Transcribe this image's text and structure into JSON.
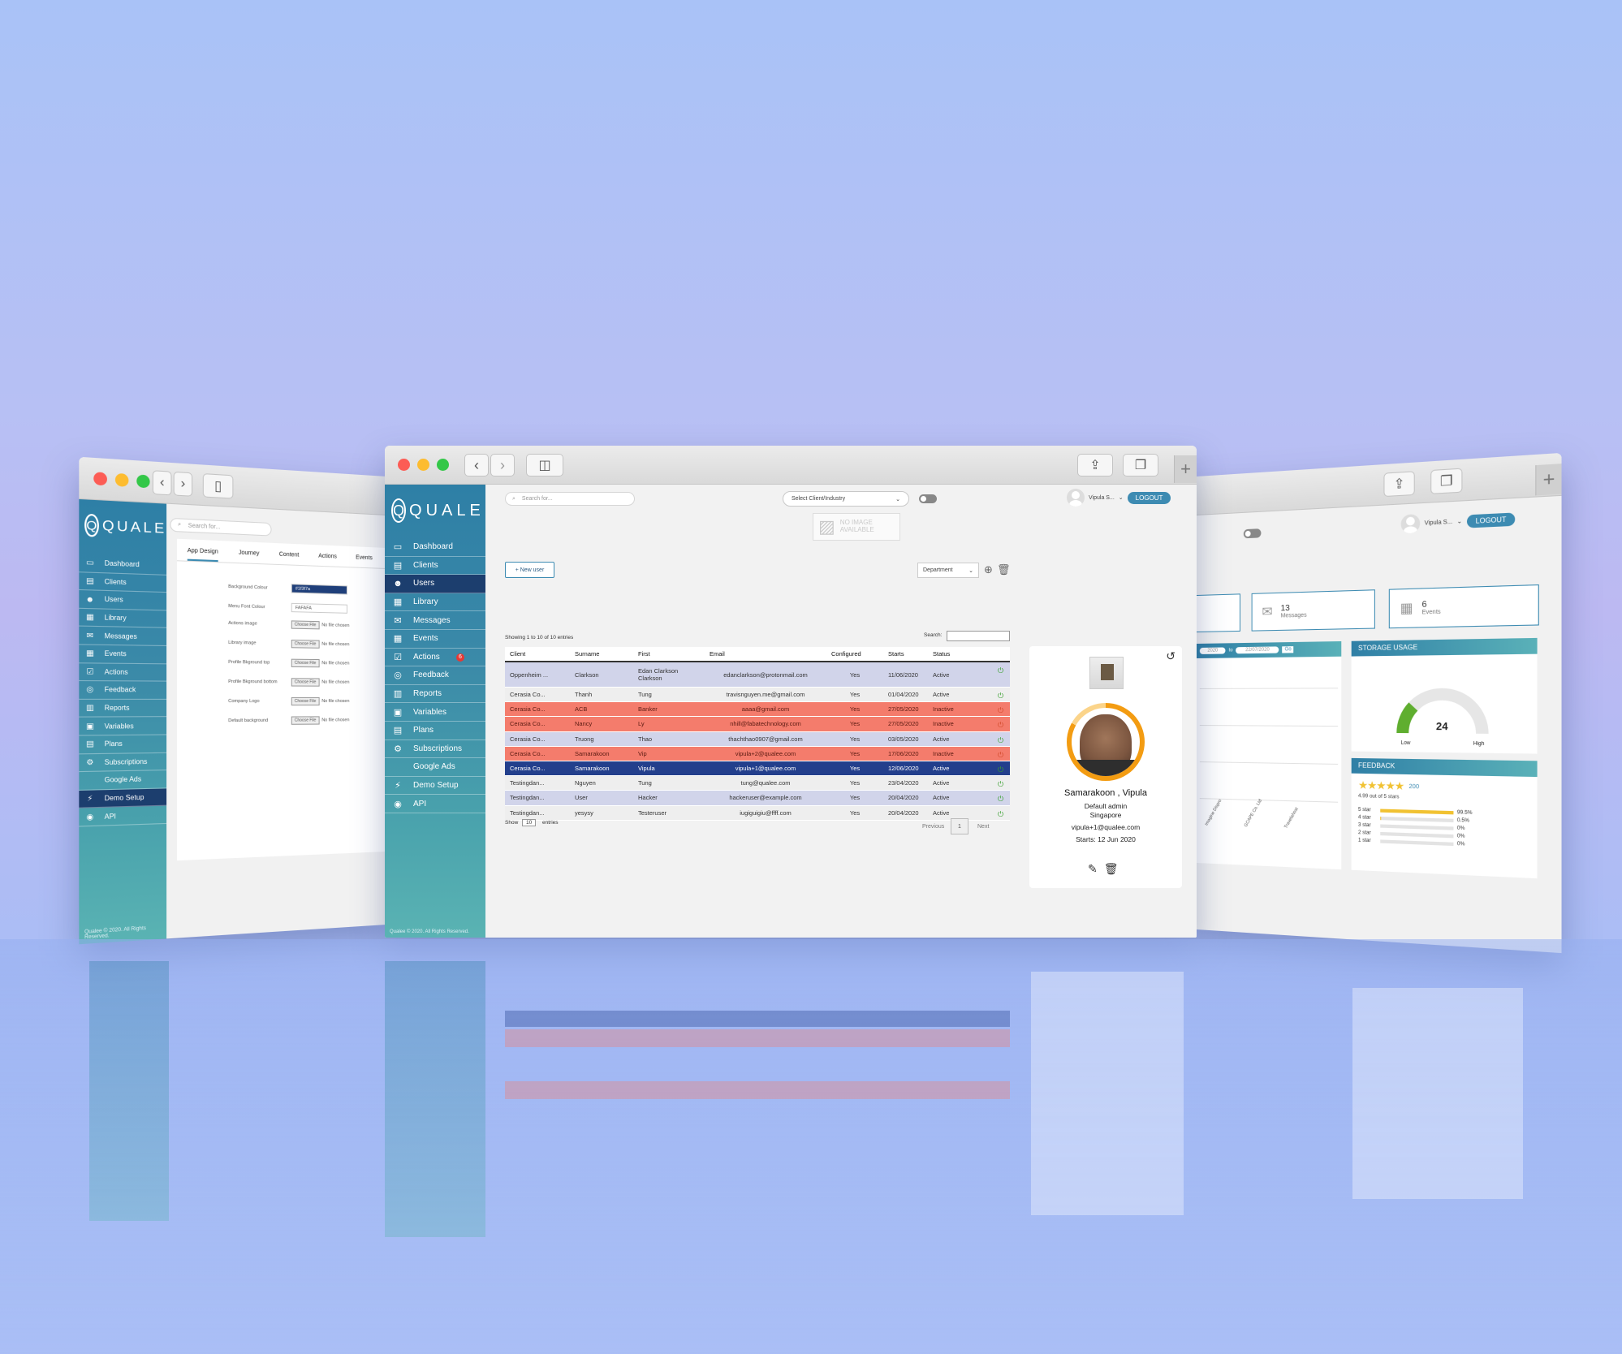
{
  "main": {
    "logo": "QUALEE",
    "nav": [
      {
        "icon": "monitor-icon",
        "glyph": "▭",
        "label": "Dashboard"
      },
      {
        "icon": "document-icon",
        "glyph": "▤",
        "label": "Clients"
      },
      {
        "icon": "users-icon",
        "glyph": "☻",
        "label": "Users",
        "active": true
      },
      {
        "icon": "library-icon",
        "glyph": "▦",
        "label": "Library"
      },
      {
        "icon": "messages-icon",
        "glyph": "✉",
        "label": "Messages"
      },
      {
        "icon": "calendar-icon",
        "glyph": "▦",
        "label": "Events"
      },
      {
        "icon": "checkbox-icon",
        "glyph": "☑",
        "label": "Actions",
        "badge": "6"
      },
      {
        "icon": "feedback-icon",
        "glyph": "◎",
        "label": "Feedback"
      },
      {
        "icon": "reports-icon",
        "glyph": "▥",
        "label": "Reports"
      },
      {
        "icon": "variables-icon",
        "glyph": "▣",
        "label": "Variables"
      },
      {
        "icon": "plans-icon",
        "glyph": "▤",
        "label": "Plans"
      },
      {
        "icon": "subscriptions-icon",
        "glyph": "⚙",
        "label": "Subscriptions"
      },
      {
        "icon": "",
        "glyph": "",
        "label": "Google Ads"
      },
      {
        "icon": "demo-icon",
        "glyph": "⚡",
        "label": "Demo Setup"
      },
      {
        "icon": "api-icon",
        "glyph": "◉",
        "label": "API"
      }
    ],
    "footer": "Qualee © 2020. All Rights Reserved.",
    "search_placeholder": "Search for...",
    "client_select": "Select Client/Industry",
    "user_name": "Vipula S...",
    "logout": "LOGOUT",
    "no_image": [
      "NO IMAGE",
      "AVAILABLE"
    ],
    "new_user": "+ New user",
    "department": "Department",
    "showing": "Showing 1 to 10 of 10 entries",
    "search_label": "Search:",
    "columns": [
      "Client",
      "Surname",
      "First",
      "Email",
      "Configured",
      "Starts",
      "Status"
    ],
    "rows": [
      {
        "style": "lav",
        "client": "Oppenheim ...",
        "surname": "Clarkson",
        "first": "Edan Clarkson Clarkson",
        "email": "edanclarkson@protonmail.com",
        "configured": "Yes",
        "starts": "11/06/2020",
        "status": "Active",
        "power": "on"
      },
      {
        "style": "white",
        "client": "Cerasia Co...",
        "surname": "Thanh",
        "first": "Tung",
        "email": "travisnguyen.me@gmail.com",
        "configured": "Yes",
        "starts": "01/04/2020",
        "status": "Active",
        "power": "on"
      },
      {
        "style": "red",
        "client": "Cerasia Co...",
        "surname": "ACB",
        "first": "Banker",
        "email": "aaaa@gmail.com",
        "configured": "Yes",
        "starts": "27/05/2020",
        "status": "Inactive",
        "power": "off"
      },
      {
        "style": "red",
        "client": "Cerasia Co...",
        "surname": "Nancy",
        "first": "Ly",
        "email": "nhill@fabatechnology.com",
        "configured": "Yes",
        "starts": "27/05/2020",
        "status": "Inactive",
        "power": "off"
      },
      {
        "style": "lav",
        "client": "Cerasia Co...",
        "surname": "Truong",
        "first": "Thao",
        "email": "thachthao0907@gmail.com",
        "configured": "Yes",
        "starts": "03/05/2020",
        "status": "Active",
        "power": "on"
      },
      {
        "style": "red",
        "client": "Cerasia Co...",
        "surname": "Samarakoon",
        "first": "Vip",
        "email": "vipula+2@qualee.com",
        "configured": "Yes",
        "starts": "17/06/2020",
        "status": "Inactive",
        "power": "off"
      },
      {
        "style": "navy",
        "client": "Cerasia Co...",
        "surname": "Samarakoon",
        "first": "Vipula",
        "email": "vipula+1@qualee.com",
        "configured": "Yes",
        "starts": "12/06/2020",
        "status": "Active",
        "power": "on"
      },
      {
        "style": "white",
        "client": "Testingdan...",
        "surname": "Nguyen",
        "first": "Tung",
        "email": "tung@qualee.com",
        "configured": "Yes",
        "starts": "23/04/2020",
        "status": "Active",
        "power": "on"
      },
      {
        "style": "lav",
        "client": "Testingdan...",
        "surname": "User",
        "first": "Hacker",
        "email": "hackeruser@example.com",
        "configured": "Yes",
        "starts": "20/04/2020",
        "status": "Active",
        "power": "on"
      },
      {
        "style": "white",
        "client": "Testingdan...",
        "surname": "yesysy",
        "first": "Testeruser",
        "email": "iugiguigiu@ffff.com",
        "configured": "Yes",
        "starts": "20/04/2020",
        "status": "Active",
        "power": "on"
      }
    ],
    "show_label": "Show",
    "show_value": "10",
    "entries_label": "entries",
    "previous": "Previous",
    "page": "1",
    "next": "Next",
    "profile": {
      "name": "Samarakoon , Vipula",
      "role": "Default admin",
      "location": "Singapore",
      "email": "vipula+1@qualee.com",
      "starts": "Starts: 12 Jun 2020",
      "photo_progress": 0.83
    }
  },
  "left": {
    "logo": "QUALEE",
    "search_placeholder": "Search for...",
    "nav": [
      "Dashboard",
      "Clients",
      "Users",
      "Library",
      "Messages",
      "Events",
      "Actions",
      "Feedback",
      "Reports",
      "Variables",
      "Plans",
      "Subscriptions",
      "Google Ads",
      "Demo Setup",
      "API"
    ],
    "active_index": 13,
    "tabs": [
      "App Design",
      "Journey",
      "Content",
      "Actions",
      "Events"
    ],
    "fields": [
      {
        "label": "Background Colour",
        "value": "#1f3f7a",
        "type": "color"
      },
      {
        "label": "Menu Font Colour",
        "value": "FAFAFA",
        "type": "text"
      },
      {
        "label": "Actions image",
        "value": "No file chosen",
        "type": "file"
      },
      {
        "label": "Library image",
        "value": "No file chosen",
        "type": "file"
      },
      {
        "label": "Profile Bkground top",
        "value": "No file chosen",
        "type": "file"
      },
      {
        "label": "Profile Bkground bottom",
        "value": "No file chosen",
        "type": "file"
      },
      {
        "label": "Company Logo",
        "value": "No file chosen",
        "type": "file"
      },
      {
        "label": "Default background",
        "value": "No file chosen",
        "type": "file"
      }
    ],
    "choose_file": "Choose File",
    "footer": "Qualee © 2020. All Rights Reserved."
  },
  "right": {
    "user_name": "Vipula S...",
    "logout": "LOGOUT",
    "stats": [
      {
        "icon": "mail-icon",
        "num": "13",
        "label": "Messages"
      },
      {
        "icon": "calendar-icon",
        "num": "6",
        "label": "Events"
      }
    ],
    "date_to": "to",
    "date_from_value": "2020",
    "date_to_value": "22/07/2020",
    "go": "Go",
    "x_labels": [
      "Imagine Dispro",
      "GCAPE Co. Ltd",
      "Travelahost"
    ],
    "storage": {
      "title": "STORAGE USAGE",
      "value": "24",
      "low": "Low",
      "high": "High",
      "level": 0.24
    },
    "feedback": {
      "title": "FEEDBACK",
      "count": "200",
      "summary": "4.99 out of 5 stars",
      "stars": 5,
      "bars": [
        {
          "label": "5 star",
          "pct": "99.5%",
          "value": 0.995
        },
        {
          "label": "4 star",
          "pct": "0.5%",
          "value": 0.005
        },
        {
          "label": "3 star",
          "pct": "0%",
          "value": 0
        },
        {
          "label": "2 star",
          "pct": "0%",
          "value": 0
        },
        {
          "label": "1 star",
          "pct": "0%",
          "value": 0
        }
      ]
    }
  }
}
